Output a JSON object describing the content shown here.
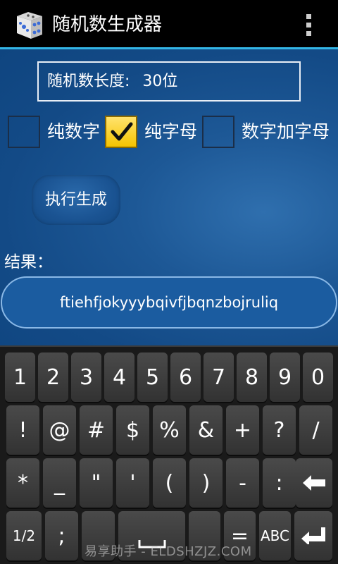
{
  "app": {
    "title": "随机数生成器",
    "icon": "dice-icon"
  },
  "length": {
    "label": "随机数长度:",
    "value": "30位"
  },
  "options": [
    {
      "label": "纯数字",
      "checked": false
    },
    {
      "label": "纯字母",
      "checked": true
    },
    {
      "label": "数字加字母",
      "checked": false
    }
  ],
  "execute_label": "执行生成",
  "result": {
    "label": "结果：",
    "value": "ftiehfjokyyybqivfjbqnzbojruliq"
  },
  "keyboard": {
    "row1": [
      "1",
      "2",
      "3",
      "4",
      "5",
      "6",
      "7",
      "8",
      "9",
      "0"
    ],
    "row2": [
      "!",
      "@",
      "#",
      "$",
      "%",
      "&",
      "+",
      "?",
      "/"
    ],
    "row3": [
      "*",
      "_",
      "\"",
      "'",
      "(",
      ")",
      "-",
      ":",
      "⇐"
    ],
    "row4": [
      "1/2",
      ";",
      "",
      "",
      "=",
      "ABC",
      "↵"
    ]
  },
  "watermark": "易享助手 - ELDSHZJZ.COM",
  "colors": {
    "accent": "#33b5e5",
    "content_bg": "#134a86",
    "checkbox_checked": "#f6c400"
  }
}
